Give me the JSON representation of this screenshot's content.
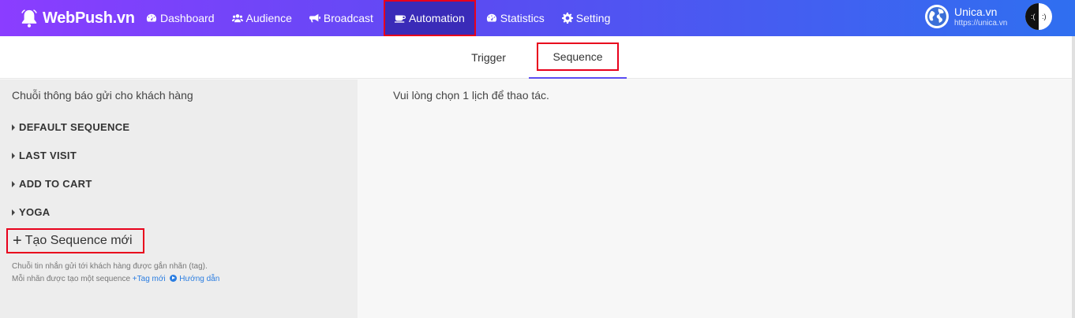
{
  "app": {
    "logo_text": "WebPush.vn",
    "brand_gradient": [
      "#8b3dff",
      "#5a4cf2",
      "#2f6ff0"
    ]
  },
  "nav": {
    "items": [
      {
        "label": "Dashboard",
        "icon": "dashboard-icon"
      },
      {
        "label": "Audience",
        "icon": "users-icon"
      },
      {
        "label": "Broadcast",
        "icon": "megaphone-icon"
      },
      {
        "label": "Automation",
        "icon": "coffee-icon",
        "active": true
      },
      {
        "label": "Statistics",
        "icon": "dashboard-icon"
      },
      {
        "label": "Setting",
        "icon": "gear-icon"
      }
    ]
  },
  "account": {
    "name": "Unica.vn",
    "url": "https://unica.vn"
  },
  "tabs": [
    {
      "label": "Trigger"
    },
    {
      "label": "Sequence",
      "active": true
    }
  ],
  "sidebar": {
    "title": "Chuỗi thông báo gửi cho khách hàng",
    "sequences": [
      "DEFAULT SEQUENCE",
      "LAST VISIT",
      "ADD TO CART",
      "YOGA"
    ],
    "new_button": "Tạo Sequence mới",
    "help_line1": "Chuỗi tin nhắn gửi tới khách hàng được gắn nhãn (tag).",
    "help_line2": "Mỗi nhãn được tạo một sequence",
    "new_tag_link": "+Tag mới",
    "guide_link": "Hướng dẫn"
  },
  "main": {
    "message": "Vui lòng chọn 1 lịch để thao tác."
  },
  "colors": {
    "highlight": "#e8001c",
    "link": "#2a7de1",
    "active_tab_underline": "#5a4cf2"
  }
}
